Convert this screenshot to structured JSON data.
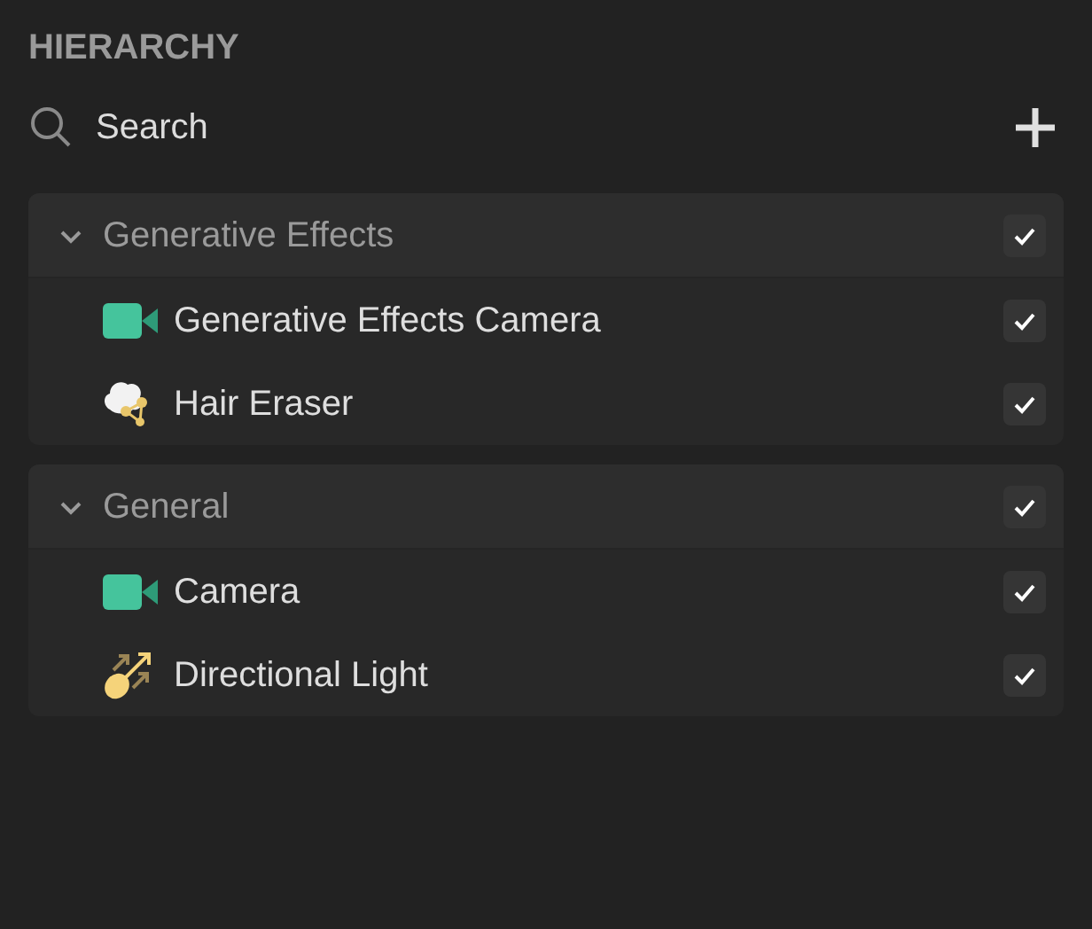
{
  "title": "HIERARCHY",
  "search": {
    "placeholder": "Search"
  },
  "groups": [
    {
      "name": "Generative Effects",
      "expanded": true,
      "checked": true,
      "children": [
        {
          "name": "Generative Effects Camera",
          "kind": "camera",
          "checked": true
        },
        {
          "name": "Hair Eraser",
          "kind": "eraser",
          "checked": true
        }
      ]
    },
    {
      "name": "General",
      "expanded": true,
      "checked": true,
      "children": [
        {
          "name": "Camera",
          "kind": "camera",
          "checked": true
        },
        {
          "name": "Directional Light",
          "kind": "light",
          "checked": true
        }
      ]
    }
  ]
}
